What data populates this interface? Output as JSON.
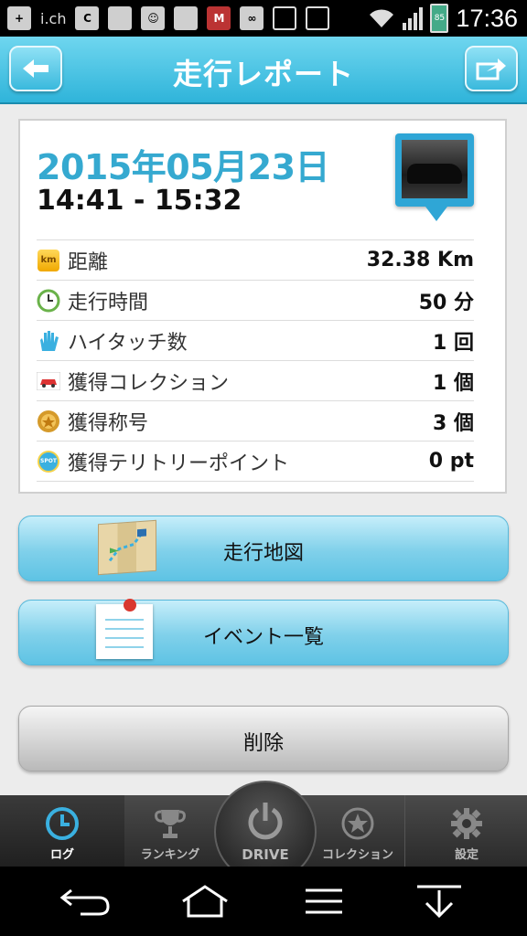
{
  "status_bar": {
    "time": "17:36",
    "battery_level": "85",
    "icon_names": [
      "add-icon",
      "ichannel-icon",
      "c-icon",
      "blank-icon",
      "smile-icon",
      "blank-icon",
      "mcafee-icon",
      "voicemail-icon",
      "android-icon",
      "vibrate-icon",
      "wifi-icon",
      "signal-icon",
      "battery-icon"
    ],
    "ichannel_label": "i.ch"
  },
  "header": {
    "title": "走行レポート",
    "back_icon": "back-arrow-icon",
    "share_icon": "share-icon"
  },
  "report": {
    "date": "2015年05月23日",
    "time_range": "14:41 - 15:32",
    "stats": [
      {
        "label": "距離",
        "value": "32.38 Km",
        "icon": "km-icon",
        "icon_text": "km"
      },
      {
        "label": "走行時間",
        "value": "50 分",
        "icon": "clock-icon"
      },
      {
        "label": "ハイタッチ数",
        "value": "1 回",
        "icon": "hi-touch-icon"
      },
      {
        "label": "獲得コレクション",
        "value": "1 個",
        "icon": "car-collection-icon"
      },
      {
        "label": "獲得称号",
        "value": "3 個",
        "icon": "medal-icon"
      },
      {
        "label": "獲得テリトリーポイント",
        "value": "0 pt",
        "icon": "spot-icon",
        "icon_text": "SPOT"
      }
    ]
  },
  "buttons": {
    "map": "走行地図",
    "events": "イベント一覧",
    "delete": "削除"
  },
  "bottom_nav": {
    "items": [
      {
        "label": "ログ",
        "icon": "clock-icon",
        "active": true
      },
      {
        "label": "ランキング",
        "icon": "trophy-icon"
      },
      {
        "label": "DRIVE",
        "icon": "power-icon"
      },
      {
        "label": "コレクション",
        "icon": "star-icon"
      },
      {
        "label": "設定",
        "icon": "gear-icon"
      }
    ]
  },
  "colors": {
    "accent": "#2fb4da",
    "date": "#35a9d0"
  }
}
